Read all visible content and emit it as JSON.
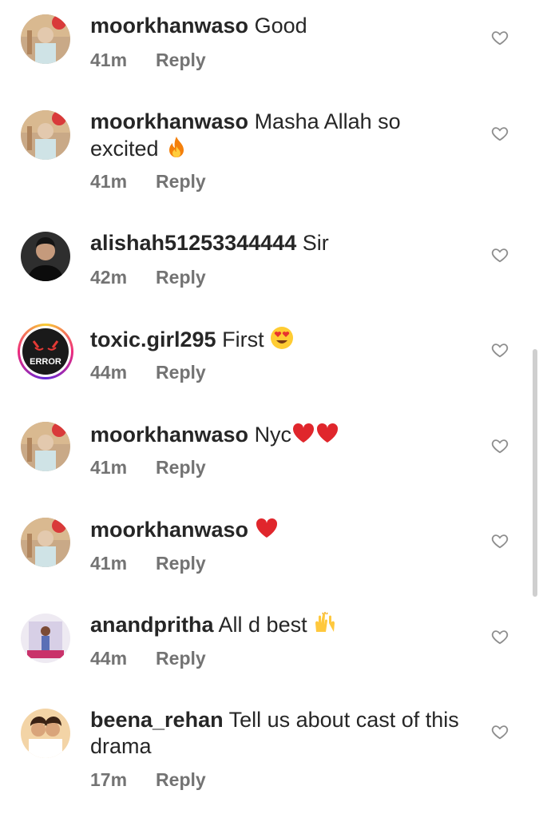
{
  "comments": [
    {
      "username": "moorkhanwaso",
      "text": "Good",
      "time": "41m",
      "reply_label": "Reply",
      "avatar": "avatar-moorkhanwaso"
    },
    {
      "username": "moorkhanwaso",
      "text": "Masha Allah so excited",
      "time": "41m",
      "reply_label": "Reply",
      "avatar": "avatar-moorkhanwaso",
      "emoji": "fire"
    },
    {
      "username": "alishah51253344444",
      "text": "Sir",
      "time": "42m",
      "reply_label": "Reply",
      "avatar": "avatar-alishah"
    },
    {
      "username": "toxic.girl295",
      "text": "First",
      "time": "44m",
      "reply_label": "Reply",
      "avatar": "avatar-toxic-girl",
      "emoji": "heart-eyes",
      "avatar_text": "ERROR"
    },
    {
      "username": "moorkhanwaso",
      "text": "Nyc",
      "time": "41m",
      "reply_label": "Reply",
      "avatar": "avatar-moorkhanwaso",
      "emoji": "red-heart-x2"
    },
    {
      "username": "moorkhanwaso",
      "text": "",
      "time": "41m",
      "reply_label": "Reply",
      "avatar": "avatar-moorkhanwaso",
      "emoji": "red-heart"
    },
    {
      "username": "anandpritha",
      "text": "All d best",
      "time": "44m",
      "reply_label": "Reply",
      "avatar": "avatar-anandpritha",
      "emoji": "raised-hands"
    },
    {
      "username": "beena_rehan",
      "text": "Tell us about cast of this drama",
      "time": "17m",
      "reply_label": "Reply",
      "avatar": "avatar-beena-rehan"
    }
  ],
  "icons": {
    "like": "heart-outline-icon"
  },
  "colors": {
    "text": "#262626",
    "meta": "#737373",
    "like_icon": "#8e8e8e",
    "scrollbar": "#cfcfcf"
  }
}
